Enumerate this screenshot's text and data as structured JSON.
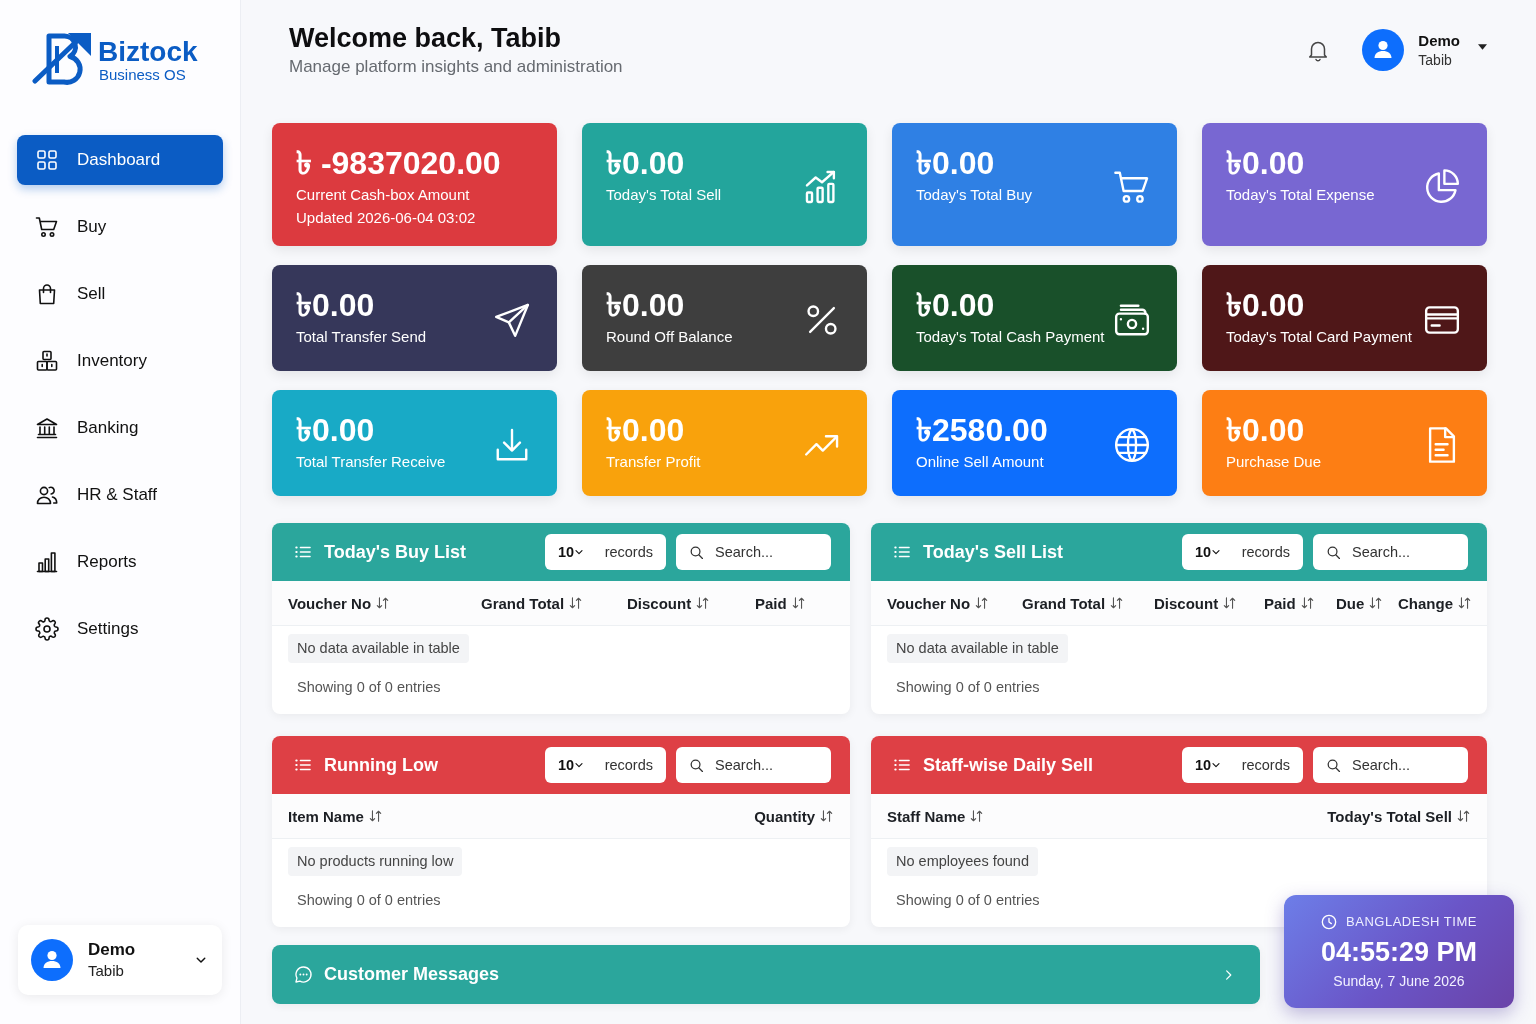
{
  "sidebar": {
    "brand": {
      "name": "Biztock",
      "tagline": "Business OS"
    },
    "nav": [
      {
        "label": "Dashboard",
        "selected": true
      },
      {
        "label": "Buy",
        "selected": false
      },
      {
        "label": "Sell",
        "selected": false
      },
      {
        "label": "Inventory",
        "selected": false
      },
      {
        "label": "Banking",
        "selected": false
      },
      {
        "label": "HR & Staff",
        "selected": false
      },
      {
        "label": "Reports",
        "selected": false
      },
      {
        "label": "Settings",
        "selected": false
      }
    ],
    "user": {
      "name": "Demo",
      "role": "Tabib"
    }
  },
  "header": {
    "title": "Welcome back, Tabib",
    "subtitle": "Manage platform insights and administration",
    "user": {
      "name": "Demo",
      "role": "Tabib"
    }
  },
  "stat_cards": [
    {
      "amount": "৳ -9837020.00",
      "label": "Current Cash-box Amount",
      "note": "Updated 2026-06-04 03:02",
      "color": "#dc3a3f"
    },
    {
      "amount": "৳0.00",
      "label": "Today's Total Sell",
      "color": "#23a59c"
    },
    {
      "amount": "৳0.00",
      "label": "Today's Total Buy",
      "color": "#2f80e4"
    },
    {
      "amount": "৳0.00",
      "label": "Today's Total Expense",
      "color": "#7867d2"
    },
    {
      "amount": "৳0.00",
      "label": "Total Transfer Send",
      "color": "#36375a"
    },
    {
      "amount": "৳0.00",
      "label": "Round Off Balance",
      "color": "#3e3e3e"
    },
    {
      "amount": "৳0.00",
      "label": "Today's Total Cash Payment",
      "color": "#19502a"
    },
    {
      "amount": "৳0.00",
      "label": "Today's Total Card Payment",
      "color": "#4f1718"
    },
    {
      "amount": "৳0.00",
      "label": "Total Transfer Receive",
      "color": "#18aac6"
    },
    {
      "amount": "৳0.00",
      "label": "Transfer Profit",
      "color": "#f9a20c"
    },
    {
      "amount": "৳2580.00",
      "label": "Online Sell Amount",
      "color": "#0d6efd"
    },
    {
      "amount": "৳0.00",
      "label": "Purchase Due",
      "color": "#fd7e14"
    }
  ],
  "tables": [
    {
      "title": "Today's Buy List",
      "color": "#2ba69c",
      "page_size": "10",
      "page_size_label": "records",
      "search_placeholder": "Search...",
      "columns": [
        "Voucher No",
        "Grand Total",
        "Discount",
        "Paid"
      ],
      "empty_message": "No data available in table",
      "info": "Showing 0 of 0 entries"
    },
    {
      "title": "Today's Sell List",
      "color": "#2ba69c",
      "page_size": "10",
      "page_size_label": "records",
      "search_placeholder": "Search...",
      "columns": [
        "Voucher No",
        "Grand Total",
        "Discount",
        "Paid",
        "Due",
        "Change"
      ],
      "empty_message": "No data available in table",
      "info": "Showing 0 of 0 entries"
    },
    {
      "title": "Running Low",
      "color": "#de4045",
      "page_size": "10",
      "page_size_label": "records",
      "search_placeholder": "Search...",
      "columns": [
        "Item Name",
        "Quantity"
      ],
      "empty_message": "No products running low",
      "info": "Showing 0 of 0 entries"
    },
    {
      "title": "Staff-wise Daily Sell",
      "color": "#de4045",
      "page_size": "10",
      "page_size_label": "records",
      "search_placeholder": "Search...",
      "columns": [
        "Staff Name",
        "Today's Total Sell"
      ],
      "empty_message": "No employees found",
      "info": "Showing 0 of 0 entries"
    }
  ],
  "messages_bar": {
    "title": "Customer Messages"
  },
  "clock": {
    "label": "BANGLADESH TIME",
    "time": "04:55:29 PM",
    "date": "Sunday, 7 June 2026"
  }
}
